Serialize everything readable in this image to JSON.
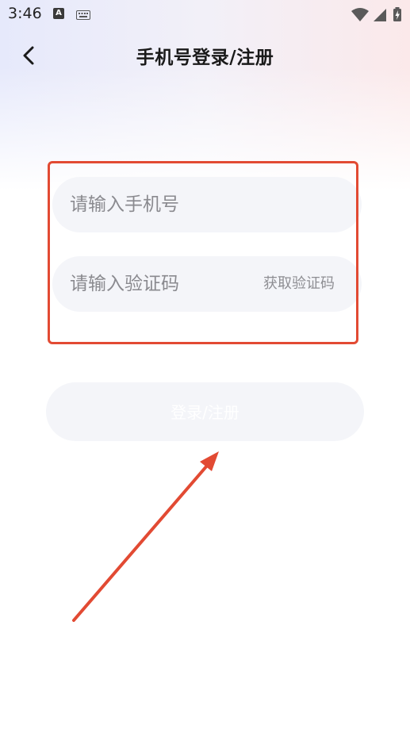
{
  "status_bar": {
    "time": "3:46",
    "left_icons": [
      "a-notification-icon",
      "keyboard-icon"
    ],
    "right_icons": [
      "wifi-icon",
      "cellular-signal-icon",
      "battery-charging-icon"
    ],
    "a_icon_glyph": "A"
  },
  "header": {
    "back_icon": "chevron-left-icon",
    "title": "手机号登录/注册"
  },
  "form": {
    "phone_placeholder": "请输入手机号",
    "phone_value": "",
    "code_placeholder": "请输入验证码",
    "code_value": "",
    "get_code_label": "获取验证码",
    "submit_label": "登录/注册"
  },
  "annotation": {
    "highlight_color": "#e24a33",
    "arrow_color": "#e24a33"
  },
  "colors": {
    "input_bg": "#f4f5f9",
    "placeholder": "#8a8a8f",
    "button_text": "#ffffff",
    "title": "#1a1a1a"
  }
}
